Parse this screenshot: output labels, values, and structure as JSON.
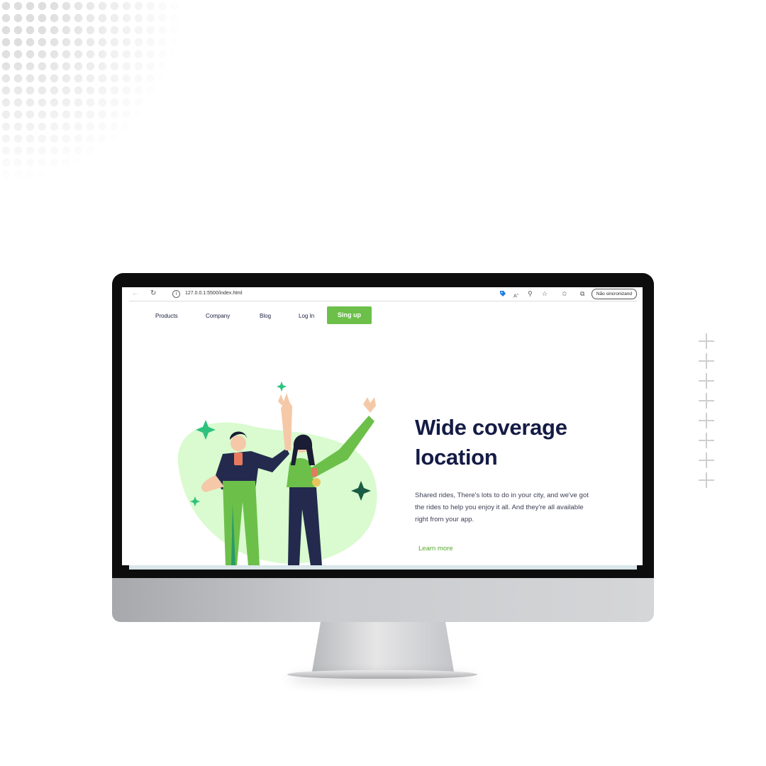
{
  "browser": {
    "url": "127.0.0.1:5500/index.html",
    "sync_label": "Não sincronizand",
    "icons": [
      "back-icon",
      "reload-icon",
      "info-icon",
      "tag-icon",
      "read-aloud-icon",
      "zoom-icon",
      "favorite-add-icon",
      "favorites-icon",
      "collections-icon"
    ]
  },
  "nav": {
    "items": [
      {
        "label": "Products"
      },
      {
        "label": "Company"
      },
      {
        "label": "Blog"
      },
      {
        "label": "Log In"
      }
    ],
    "cta": "Sing up"
  },
  "hero": {
    "title_line1": "Wide coverage",
    "title_line2": "location",
    "description": "Shared rides, There's lots to do in your city, and we've got the rides to help you enjoy it all. And they're all available right from your app.",
    "link": "Learn more"
  },
  "colors": {
    "accent": "#6cc04a",
    "heading": "#141b45",
    "blob": "#d9fbcf",
    "bezel": "#0d0d0d"
  }
}
